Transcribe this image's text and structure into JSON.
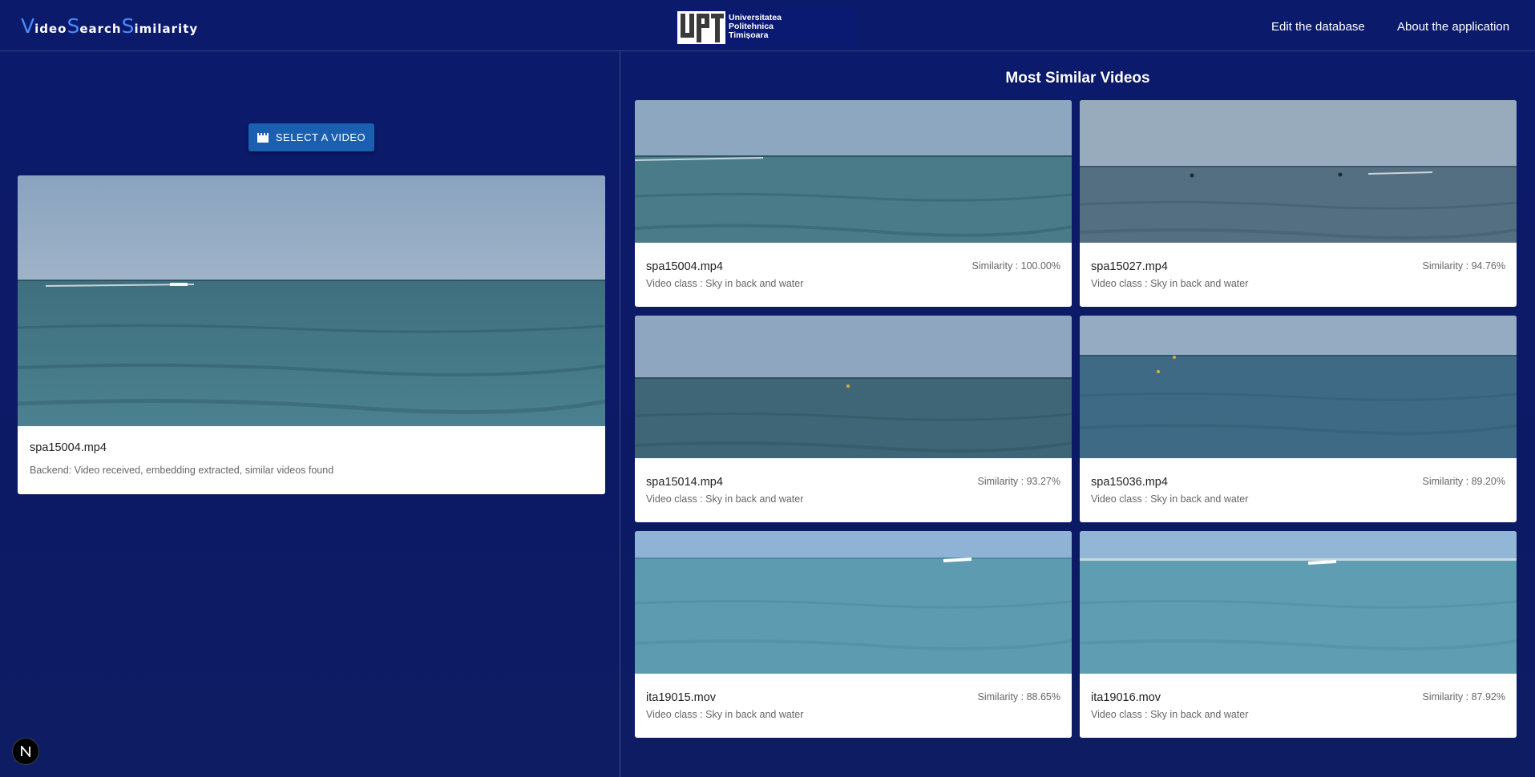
{
  "app": {
    "brand_letters": [
      {
        "cap": "V",
        "rest": "ideo"
      },
      {
        "cap": "S",
        "rest": "earch"
      },
      {
        "cap": "S",
        "rest": "imilarity"
      }
    ],
    "logo_text": [
      "Universitatea",
      "Politehnica",
      "Timișoara"
    ],
    "logo_mark": "UPT"
  },
  "nav": {
    "edit_label": "Edit the database",
    "about_label": "About the application"
  },
  "query": {
    "select_button_label": "SELECT A VIDEO",
    "filename": "spa15004.mp4",
    "status": "Backend: Video received, embedding extracted, similar videos found"
  },
  "results": {
    "heading": "Most Similar Videos",
    "items": [
      {
        "filename": "spa15004.mp4",
        "similarity": "Similarity : 100.00%",
        "video_class": "Video class : Sky in back and water"
      },
      {
        "filename": "spa15027.mp4",
        "similarity": "Similarity : 94.76%",
        "video_class": "Video class : Sky in back and water"
      },
      {
        "filename": "spa15014.mp4",
        "similarity": "Similarity : 93.27%",
        "video_class": "Video class : Sky in back and water"
      },
      {
        "filename": "spa15036.mp4",
        "similarity": "Similarity : 89.20%",
        "video_class": "Video class : Sky in back and water"
      },
      {
        "filename": "ita19015.mov",
        "similarity": "Similarity : 88.65%",
        "video_class": "Video class : Sky in back and water"
      },
      {
        "filename": "ita19016.mov",
        "similarity": "Similarity : 87.92%",
        "video_class": "Video class : Sky in back and water"
      }
    ]
  },
  "colors": {
    "background": "#0b1a6b",
    "accent": "#4a8cff",
    "button": "#1a5fb0"
  },
  "icons": {
    "select_button": "clapperboard-icon",
    "badge": "n-logo-icon"
  }
}
